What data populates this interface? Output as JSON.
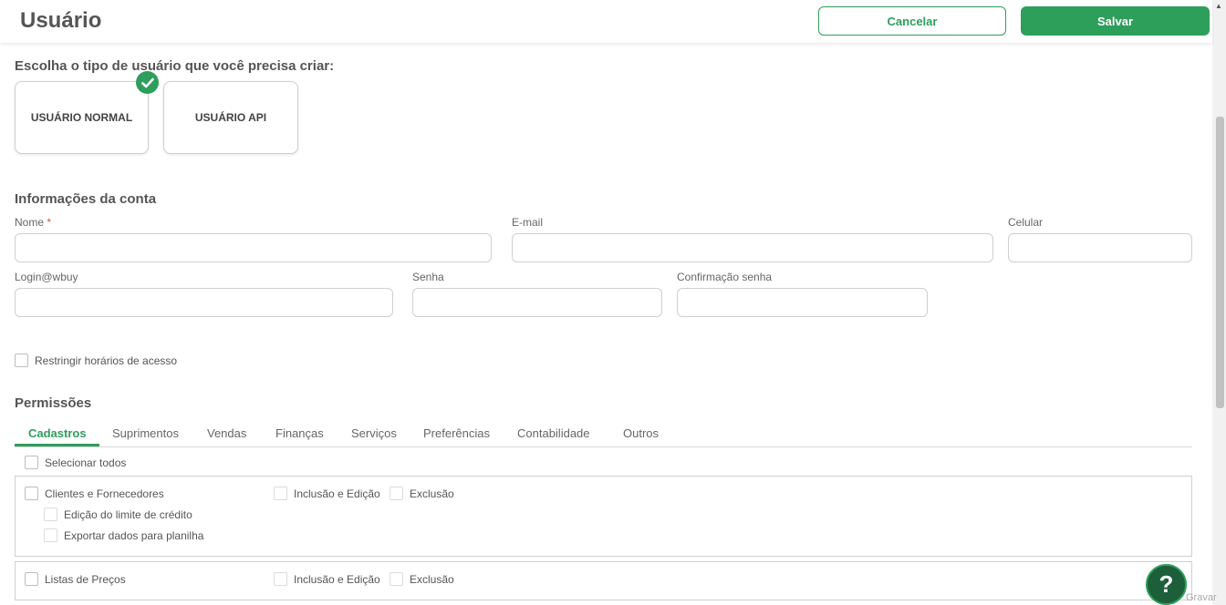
{
  "header": {
    "title": "Usuário",
    "cancel_label": "Cancelar",
    "save_label": "Salvar"
  },
  "user_type": {
    "title": "Escolha o tipo de usuário que você precisa criar:",
    "options": [
      {
        "label": "USUÁRIO NORMAL",
        "selected": true
      },
      {
        "label": "USUÁRIO API",
        "selected": false
      }
    ]
  },
  "account": {
    "title": "Informações da conta",
    "fields": {
      "nome": {
        "label": "Nome",
        "required_mark": "*",
        "value": ""
      },
      "email": {
        "label": "E-mail",
        "value": ""
      },
      "celular": {
        "label": "Celular",
        "value": ""
      },
      "login": {
        "label": "Login@wbuy",
        "value": ""
      },
      "senha": {
        "label": "Senha",
        "value": ""
      },
      "confirmacao": {
        "label": "Confirmação senha",
        "value": ""
      }
    },
    "restrict_label": "Restringir horários de acesso"
  },
  "permissions": {
    "title": "Permissões",
    "tabs": [
      "Cadastros",
      "Suprimentos",
      "Vendas",
      "Finanças",
      "Serviços",
      "Preferências",
      "Contabilidade",
      "Outros"
    ],
    "active_tab": "Cadastros",
    "select_all_label": "Selecionar todos",
    "groups": [
      {
        "label": "Clientes e Fornecedores",
        "actions": [
          "Inclusão e Edição",
          "Exclusão"
        ],
        "sub": [
          "Edição do limite de crédito",
          "Exportar dados para planilha"
        ]
      },
      {
        "label": "Listas de Preços",
        "actions": [
          "Inclusão e Edição",
          "Exclusão"
        ]
      }
    ]
  },
  "help": {
    "label": "?"
  },
  "gravar_label": "Gravar",
  "colors": {
    "accent": "#2e9e5b",
    "help_bg": "#1d5e3b"
  }
}
